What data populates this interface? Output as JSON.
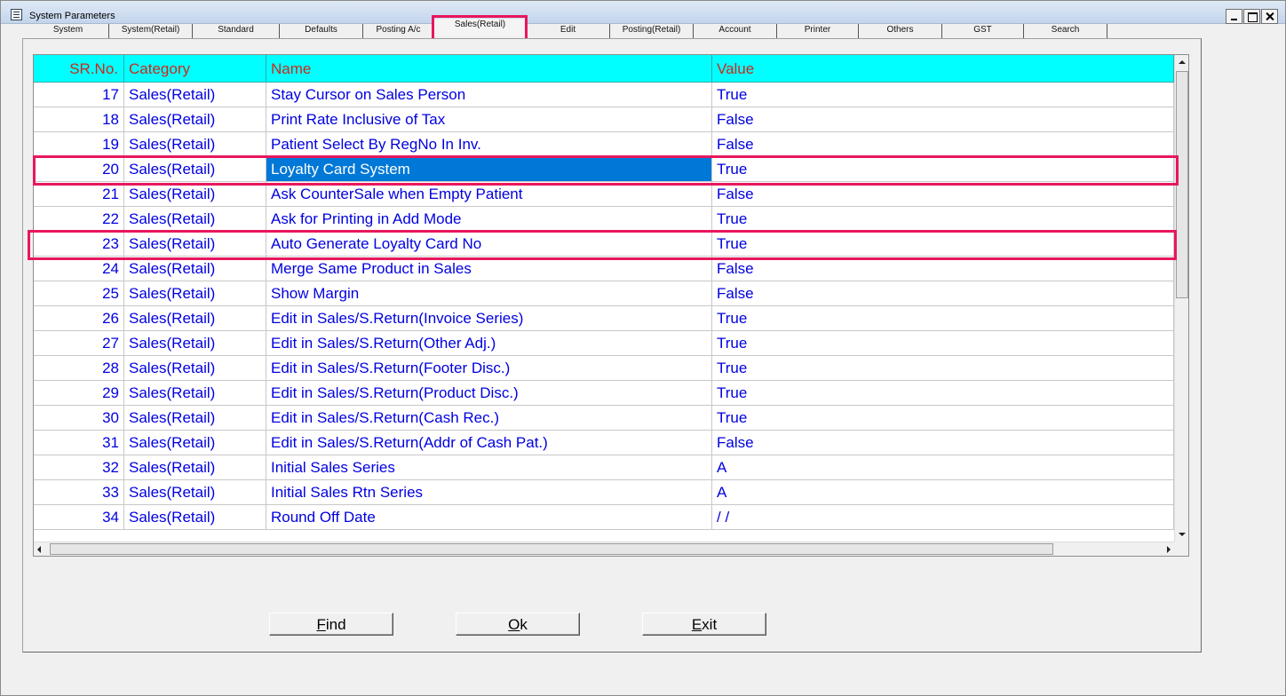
{
  "window": {
    "title": "System Parameters"
  },
  "tabs": [
    {
      "label": "System"
    },
    {
      "label": "System(Retail)"
    },
    {
      "label": "Standard"
    },
    {
      "label": "Defaults"
    },
    {
      "label": "Posting A/c"
    },
    {
      "label": "Sales(Retail)"
    },
    {
      "label": "Edit"
    },
    {
      "label": "Posting(Retail)"
    },
    {
      "label": "Account"
    },
    {
      "label": "Printer"
    },
    {
      "label": "Others"
    },
    {
      "label": "GST"
    },
    {
      "label": "Search"
    }
  ],
  "active_tab": "Sales(Retail)",
  "grid": {
    "columns": [
      "SR.No.",
      "Category",
      "Name",
      "Value"
    ],
    "rows": [
      {
        "sr": "17",
        "category": "Sales(Retail)",
        "name": "Stay Cursor on Sales Person",
        "value": "True"
      },
      {
        "sr": "18",
        "category": "Sales(Retail)",
        "name": "Print Rate Inclusive of Tax",
        "value": "False"
      },
      {
        "sr": "19",
        "category": "Sales(Retail)",
        "name": "Patient Select By RegNo In Inv.",
        "value": "False"
      },
      {
        "sr": "20",
        "category": "Sales(Retail)",
        "name": "Loyalty Card System",
        "value": "True"
      },
      {
        "sr": "21",
        "category": "Sales(Retail)",
        "name": "Ask CounterSale when Empty Patient",
        "value": "False"
      },
      {
        "sr": "22",
        "category": "Sales(Retail)",
        "name": "Ask for Printing in Add Mode",
        "value": "True"
      },
      {
        "sr": "23",
        "category": "Sales(Retail)",
        "name": "Auto Generate Loyalty Card No",
        "value": "True"
      },
      {
        "sr": "24",
        "category": "Sales(Retail)",
        "name": "Merge Same Product in Sales",
        "value": "False"
      },
      {
        "sr": "25",
        "category": "Sales(Retail)",
        "name": "Show Margin",
        "value": "False"
      },
      {
        "sr": "26",
        "category": "Sales(Retail)",
        "name": "Edit in Sales/S.Return(Invoice Series)",
        "value": "True"
      },
      {
        "sr": "27",
        "category": "Sales(Retail)",
        "name": "Edit in Sales/S.Return(Other Adj.)",
        "value": "True"
      },
      {
        "sr": "28",
        "category": "Sales(Retail)",
        "name": "Edit in Sales/S.Return(Footer Disc.)",
        "value": "True"
      },
      {
        "sr": "29",
        "category": "Sales(Retail)",
        "name": "Edit in Sales/S.Return(Product Disc.)",
        "value": "True"
      },
      {
        "sr": "30",
        "category": "Sales(Retail)",
        "name": "Edit in Sales/S.Return(Cash Rec.)",
        "value": "True"
      },
      {
        "sr": "31",
        "category": "Sales(Retail)",
        "name": "Edit in Sales/S.Return(Addr of Cash Pat.)",
        "value": "False"
      },
      {
        "sr": "32",
        "category": "Sales(Retail)",
        "name": "Initial Sales Series",
        "value": "A"
      },
      {
        "sr": "33",
        "category": "Sales(Retail)",
        "name": "Initial Sales Rtn Series",
        "value": "A"
      },
      {
        "sr": "34",
        "category": "Sales(Retail)",
        "name": "Round Off Date",
        "value": " /  /"
      }
    ],
    "selected_row": "20"
  },
  "buttons": {
    "find_pre": "",
    "find_key": "F",
    "find_post": "ind",
    "ok_pre": "",
    "ok_key": "O",
    "ok_post": "k",
    "exit_pre": "",
    "exit_key": "E",
    "exit_post": "xit"
  },
  "colors": {
    "header_bg": "#00ffff",
    "header_text": "#cc2a1a",
    "cell_text": "#0000e0",
    "selection": "#0078d7",
    "highlight_box": "#e8175d"
  }
}
